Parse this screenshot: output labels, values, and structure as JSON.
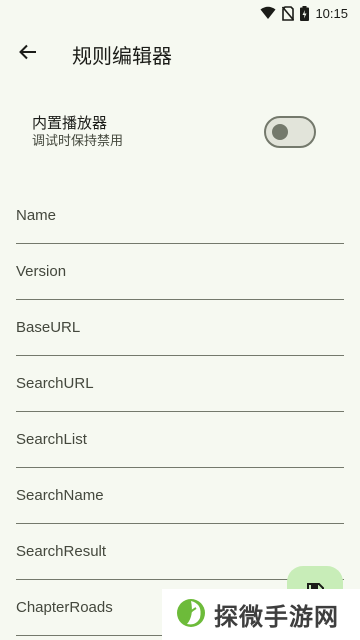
{
  "status_bar": {
    "time": "10:15",
    "icons": [
      "wifi-icon",
      "no-sim-icon",
      "battery-charging-icon"
    ]
  },
  "app_bar": {
    "back_icon": "arrow-back-icon",
    "title": "规则编辑器"
  },
  "builtin_player": {
    "title": "内置播放器",
    "subtitle": "调试时保持禁用",
    "enabled": false
  },
  "fields": [
    {
      "label": "Name",
      "value": ""
    },
    {
      "label": "Version",
      "value": ""
    },
    {
      "label": "BaseURL",
      "value": ""
    },
    {
      "label": "SearchURL",
      "value": ""
    },
    {
      "label": "SearchList",
      "value": ""
    },
    {
      "label": "SearchName",
      "value": ""
    },
    {
      "label": "SearchResult",
      "value": ""
    },
    {
      "label": "ChapterRoads",
      "value": ""
    }
  ],
  "fab": {
    "icon": "save-icon"
  },
  "watermark": {
    "text": "探微手游网",
    "icon": "leaf-logo-icon"
  },
  "colors": {
    "background": "#f6f9f1",
    "fab": "#c8edb8",
    "outline": "#74796c",
    "text": "#1b1c18"
  }
}
